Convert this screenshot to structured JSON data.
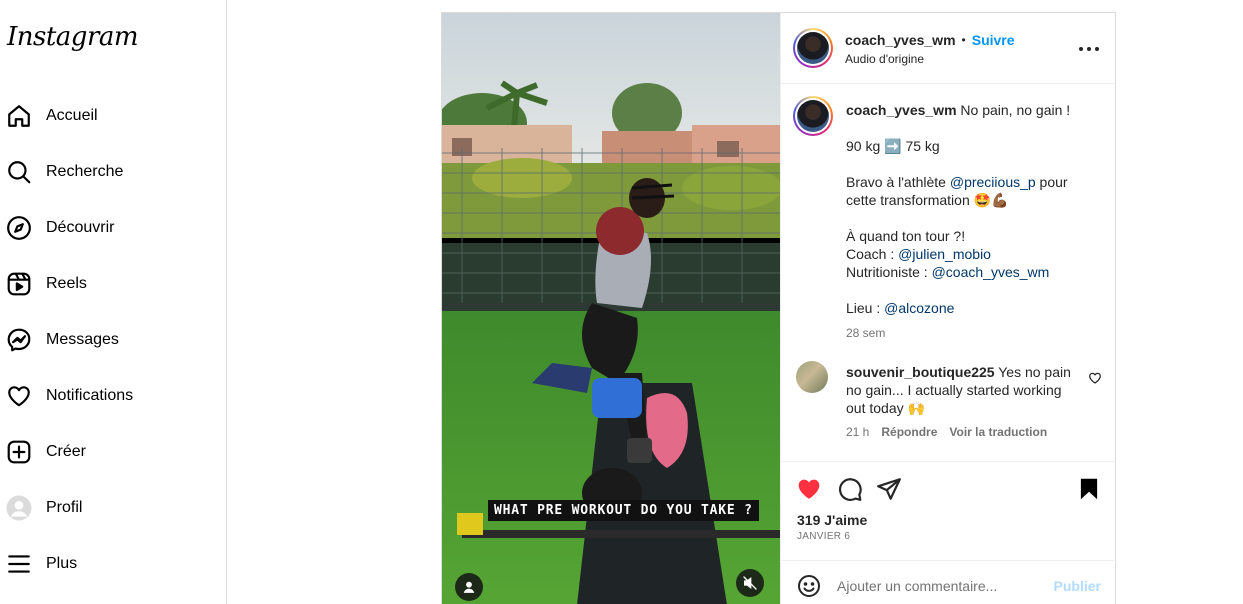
{
  "app": {
    "logo": "Instagram"
  },
  "nav": {
    "items": [
      {
        "label": "Accueil",
        "icon": "home-icon"
      },
      {
        "label": "Recherche",
        "icon": "search-icon"
      },
      {
        "label": "Découvrir",
        "icon": "compass-icon"
      },
      {
        "label": "Reels",
        "icon": "reels-icon"
      },
      {
        "label": "Messages",
        "icon": "messenger-icon"
      },
      {
        "label": "Notifications",
        "icon": "heart-icon"
      },
      {
        "label": "Créer",
        "icon": "plus-square-icon"
      },
      {
        "label": "Profil",
        "icon": "profile-avatar"
      },
      {
        "label": "Plus",
        "icon": "hamburger-menu-icon"
      }
    ]
  },
  "post": {
    "author": {
      "username": "coach_yves_wm",
      "separator": "•",
      "follow_label": "Suivre",
      "audio": "Audio d'origine"
    },
    "video": {
      "overlay_text": "WHAT PRE WORKOUT DO YOU TAKE ?",
      "controls": [
        "user-tag-icon",
        "sound-muted-icon"
      ]
    },
    "caption": {
      "username": "coach_yves_wm",
      "headline": "No pain, no gain !",
      "weight_from": "90 kg",
      "arrow": "➡️",
      "weight_to": "75 kg",
      "line_bravo_prefix": "Bravo à l'athlète ",
      "mention_athlete": "@preciious_p",
      "line_bravo_suffix": " pour cette transformation 🤩💪🏾",
      "line_question": "À quand ton tour ?!",
      "coach_label": "Coach : ",
      "mention_coach": "@julien_mobio",
      "nutri_label": "Nutritioniste : ",
      "mention_nutri": "@coach_yves_wm",
      "place_label": "Lieu : ",
      "mention_place": "@alcozone",
      "time": "28 sem"
    },
    "comment": {
      "username": "souvenir_boutique225",
      "text": " Yes no pain no gain... I actually started working out today 🙌",
      "time": "21 h",
      "reply_label": "Répondre",
      "translate_label": "Voir la traduction"
    },
    "likes_label": "319 J'aime",
    "date": "JANVIER 6",
    "add_comment": {
      "placeholder": "Ajouter un commentaire...",
      "publish_label": "Publier"
    },
    "colors": {
      "like_red": "#ff3040",
      "follow_blue": "#0095f6",
      "publish_disabled": "#b3dbff"
    }
  }
}
